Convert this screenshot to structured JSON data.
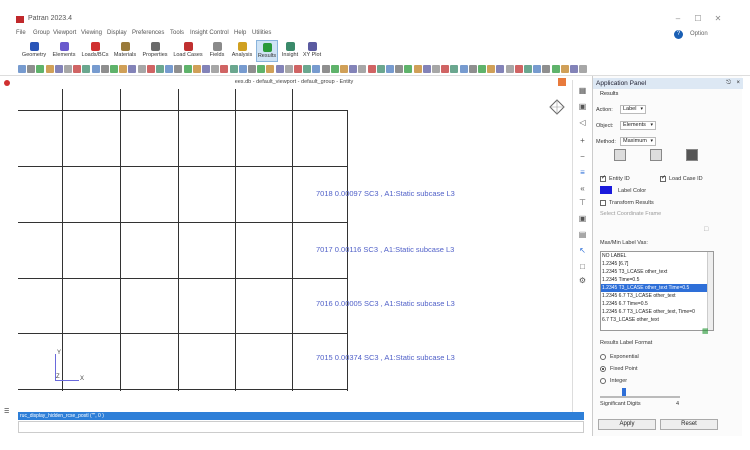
{
  "window": {
    "title": "Patran 2023.4",
    "min": "–",
    "max": "☐",
    "close": "✕"
  },
  "menu": [
    "File",
    "Group",
    "Viewport",
    "Viewing",
    "Display",
    "Preferences",
    "Tools",
    "Insight Control",
    "Help",
    "Utilities"
  ],
  "help_label": "Option",
  "ribbon": [
    {
      "label": "Geometry",
      "color": "#2a55b8"
    },
    {
      "label": "Elements",
      "color": "#6a5acd"
    },
    {
      "label": "Loads/BCs",
      "color": "#d03030"
    },
    {
      "label": "Materials",
      "color": "#9a7a3a"
    },
    {
      "label": "Properties",
      "color": "#6a6a6a"
    },
    {
      "label": "Load Cases",
      "color": "#c03030"
    },
    {
      "label": "Fields",
      "color": "#8a8a8a"
    },
    {
      "label": "Analysis",
      "color": "#d0a020"
    },
    {
      "label": "Results",
      "color": "#2a9a3a",
      "active": true
    },
    {
      "label": "Insight",
      "color": "#3a8a6a"
    },
    {
      "label": "XY Plot",
      "color": "#5a5aa0"
    }
  ],
  "viewport": {
    "title": "ees.db - default_viewport - default_group - Entity"
  },
  "element_labels": [
    "7018  0.00097 SC3 , A1:Static subcase L3",
    "7017  0.00116 SC3 , A1:Static subcase L3",
    "7016  0.00005 SC3 , A1:Static subcase L3",
    "7015  0.00374 SC3 , A1:Static subcase L3"
  ],
  "axes": {
    "y": "Y",
    "z": "Z",
    "x": "X"
  },
  "panel": {
    "title": "Application Panel",
    "section": "Results",
    "action_label": "Action:",
    "action_value": "Label",
    "object_label": "Object:",
    "object_value": "Elements",
    "method_label": "Method:",
    "method_value": "Maximum",
    "entity_id": "Entity ID",
    "load_case_id": "Load Case ID",
    "label_color": "Label Color",
    "transform": "Transform Results",
    "coord_frame": "Select Coordinate Frame",
    "list_label": "Max/Min Label Vas:",
    "list_items": [
      "NO LABEL",
      "1.2345 [6.7]",
      "1.2345 T3_LCASE other_text",
      "1.2345 Time=0.5",
      "1.2345 T3_LCASE other_text  Time=0.5",
      "1.2345 6.7 T3_LCASE other_text",
      "1.2345 6.7 Time=0.5",
      "1.2345 6.7 T3_LCASE other_text, Time=0",
      "6.7 T3_LCASE other_text"
    ],
    "selected_index": 4,
    "format_label": "Results Label Format",
    "fmt_exp": "Exponential",
    "fmt_fixed": "Fixed Point",
    "fmt_int": "Integer",
    "sig_digits": "Significant Digits",
    "sig_value": "4",
    "apply": "Apply",
    "reset": "Reset"
  },
  "command": "ruc_display_hidden_rcse_postl (\"\", 0 )"
}
